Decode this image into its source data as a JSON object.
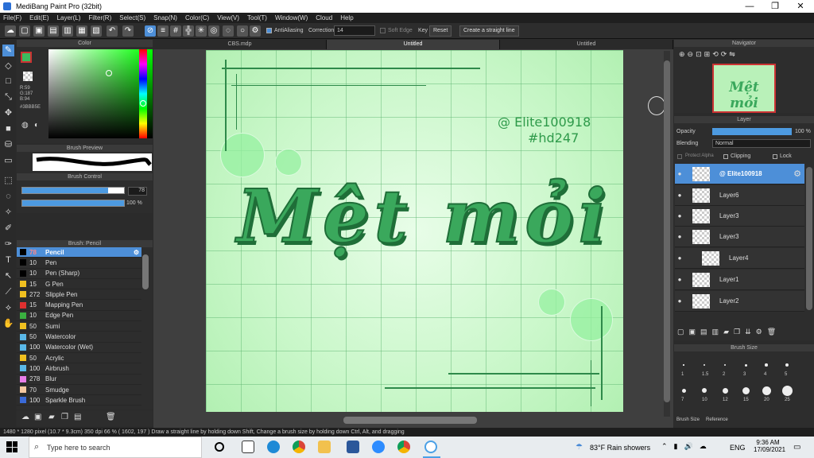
{
  "app": {
    "title": "MediBang Paint Pro (32bit)",
    "min": "—",
    "max": "❐",
    "close": "✕"
  },
  "menu": [
    "File(F)",
    "Edit(E)",
    "Layer(L)",
    "Filter(R)",
    "Select(S)",
    "Snap(N)",
    "Color(C)",
    "View(V)",
    "Tool(T)",
    "Window(W)",
    "Cloud",
    "Help"
  ],
  "toolbar": {
    "antialias": "AntiAliasing",
    "correction_label": "Correction",
    "correction_value": "14",
    "soft_edge": "Soft Edge",
    "key": "Key",
    "reset": "Reset",
    "straight": "Create a straight line"
  },
  "color_panel": {
    "title": "Color",
    "r": "R:59",
    "g": "G:187",
    "b": "B:94",
    "hex": "#3BBB5E",
    "primary": "#3bbb5e"
  },
  "brush_preview": {
    "title": "Brush Preview"
  },
  "brush_control": {
    "title": "Brush Control",
    "size_value": "78",
    "opacity_value": "100 %",
    "size_fraction": 0.84,
    "opacity_fraction": 1.0
  },
  "brush_list": {
    "title": "Brush: Pencil",
    "items": [
      {
        "size": "78",
        "name": "Pencil",
        "color": "#000000",
        "selected": true
      },
      {
        "size": "10",
        "name": "Pen",
        "color": "#000000"
      },
      {
        "size": "10",
        "name": "Pen (Sharp)",
        "color": "#000000"
      },
      {
        "size": "15",
        "name": "G Pen",
        "color": "#f0c020"
      },
      {
        "size": "272",
        "name": "Slipple Pen",
        "color": "#f0c020"
      },
      {
        "size": "15",
        "name": "Mapping Pen",
        "color": "#e03030"
      },
      {
        "size": "10",
        "name": "Edge Pen",
        "color": "#3ab040"
      },
      {
        "size": "50",
        "name": "Sumi",
        "color": "#f0c020"
      },
      {
        "size": "50",
        "name": "Watercolor",
        "color": "#5ab8e8"
      },
      {
        "size": "100",
        "name": "Watercolor (Wet)",
        "color": "#5ab8e8"
      },
      {
        "size": "50",
        "name": "Acrylic",
        "color": "#f0c020"
      },
      {
        "size": "100",
        "name": "Airbrush",
        "color": "#5ab8e8"
      },
      {
        "size": "278",
        "name": "Blur",
        "color": "#e87de8"
      },
      {
        "size": "70",
        "name": "Smudge",
        "color": "#f5c8a0"
      },
      {
        "size": "100",
        "name": "Sparkle Brush",
        "color": "#3a6ad8"
      }
    ]
  },
  "tabs": [
    "CBS.mdp",
    "Untitled",
    "Untitled"
  ],
  "canvas": {
    "title_text": "Mệt mỏi",
    "sig1": "@ Elite100918",
    "sig2": "#hd247"
  },
  "navigator": {
    "title": "Navigator",
    "thumb_text": "Mệt mỏi"
  },
  "layer_panel": {
    "title": "Layer",
    "opacity_label": "Opacity",
    "opacity_value": "100 %",
    "blending_label": "Blending",
    "blending_value": "Normal",
    "protect_alpha": "Protect Alpha",
    "clipping": "Clipping",
    "lock": "Lock",
    "layers": [
      {
        "name": "@ Elite100918",
        "selected": true
      },
      {
        "name": "Layer6"
      },
      {
        "name": "Layer3"
      },
      {
        "name": "Layer3"
      },
      {
        "name": "Layer4"
      },
      {
        "name": "Layer1"
      },
      {
        "name": "Layer2"
      }
    ]
  },
  "brush_size": {
    "title": "Brush Size",
    "labels": [
      "1",
      "1.5",
      "2",
      "3",
      "4",
      "5",
      "7",
      "10",
      "12",
      "15",
      "20",
      "25"
    ],
    "tab1": "Brush Size",
    "tab2": "Reference"
  },
  "status": "1480 * 1280 pixel   (10.7 * 9.3cm)   350 dpi   66 %   ( 1602, 197 )   Draw a straight line by holding down Shift, Change a brush size by holding down Ctrl, Alt, and dragging",
  "taskbar": {
    "search_placeholder": "Type here to search",
    "weather": "83°F  Rain showers",
    "lang": "ENG",
    "time": "9:36 AM",
    "date": "17/09/2021"
  }
}
